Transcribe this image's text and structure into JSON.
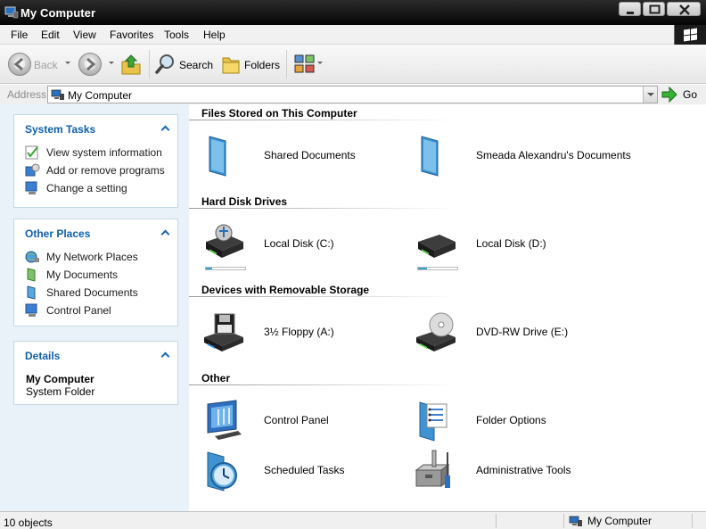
{
  "window": {
    "title": "My Computer",
    "minimize_icon": "minimize-icon",
    "maximize_icon": "maximize-icon",
    "close_icon": "close-icon"
  },
  "menu": [
    "File",
    "Edit",
    "View",
    "Favorites",
    "Tools",
    "Help"
  ],
  "toolbar": {
    "back_label": "Back",
    "search_label": "Search",
    "folders_label": "Folders"
  },
  "address": {
    "label": "Address",
    "value": "My Computer",
    "go_label": "Go"
  },
  "panels": {
    "system_tasks": {
      "title": "System Tasks",
      "items": [
        "View system information",
        "Add or remove programs",
        "Change a setting"
      ]
    },
    "other_places": {
      "title": "Other Places",
      "items": [
        "My Network Places",
        "My Documents",
        "Shared Documents",
        "Control Panel"
      ]
    },
    "details": {
      "title": "Details",
      "name": "My Computer",
      "type": "System Folder"
    }
  },
  "groups": {
    "files": {
      "title": "Files Stored on This Computer",
      "items": [
        "Shared Documents",
        "Smeada Alexandru's Documents"
      ]
    },
    "drives": {
      "title": "Hard Disk Drives",
      "items": [
        "Local Disk (C:)",
        "Local Disk (D:)"
      ],
      "used_fraction": [
        0.15,
        0.22
      ]
    },
    "removable": {
      "title": "Devices with Removable Storage",
      "items": [
        "3½ Floppy (A:)",
        "DVD-RW Drive (E:)"
      ]
    },
    "other": {
      "title": "Other",
      "items": [
        "Control Panel",
        "Folder Options",
        "Scheduled Tasks",
        "Administrative Tools"
      ]
    }
  },
  "status": {
    "count": "10 objects",
    "location": "My Computer"
  },
  "colors": {
    "title_bar": "#111111",
    "panel_title": "#0d5fa7",
    "task_pane_bg": "#e9f2f8",
    "capacity_fill": "#3aa0d0"
  }
}
